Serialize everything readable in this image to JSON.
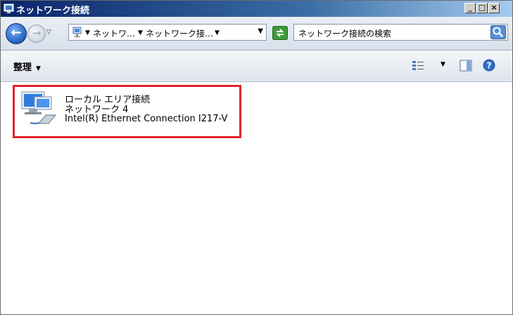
{
  "window": {
    "title": "ネットワーク接続",
    "minimize": "_",
    "maximize": "□",
    "close": "×"
  },
  "address": {
    "breadcrumb_1": "ネットワ…",
    "breadcrumb_2": "ネットワーク接…",
    "search_placeholder": "ネットワーク接続の検索"
  },
  "command_bar": {
    "organize_label": "整理"
  },
  "item": {
    "name": "ローカル エリア接続",
    "network": "ネットワーク  4",
    "adapter": "Intel(R) Ethernet Connection I217-V",
    "icon": "network-connection-icon"
  },
  "colors": {
    "highlight_border": "#e0252b",
    "titlebar_start": "#0a246a",
    "titlebar_end": "#a6caf0"
  }
}
